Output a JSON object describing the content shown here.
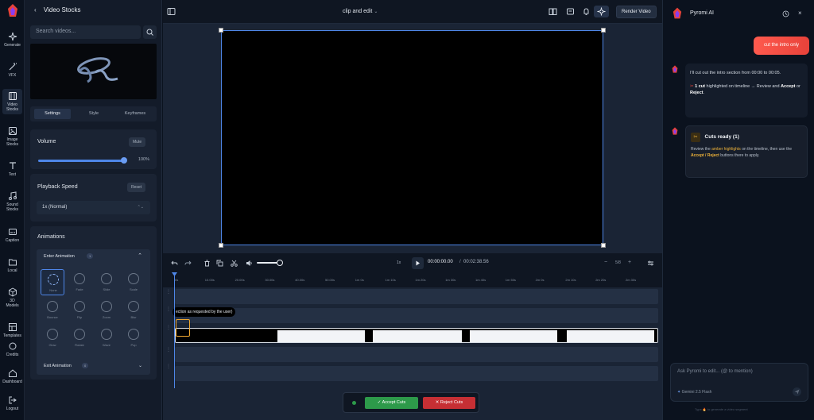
{
  "colors": {
    "accent": "#4e86e8",
    "accept": "#2d9a4a",
    "reject": "#c62f34",
    "amber": "#f0b43a",
    "user_bubble": "#ff5a4e"
  },
  "rail": {
    "items": [
      {
        "label": "Generate",
        "icon": "sparkles-icon"
      },
      {
        "label": "VFX",
        "icon": "magic-icon"
      },
      {
        "label": "Video Stocks",
        "icon": "film-icon"
      },
      {
        "label": "Image Stocks",
        "icon": "image-icon"
      },
      {
        "label": "Text",
        "icon": "text-icon"
      },
      {
        "label": "Sound Stocks",
        "icon": "music-icon"
      },
      {
        "label": "Caption",
        "icon": "caption-icon"
      },
      {
        "label": "Local",
        "icon": "folder-icon"
      },
      {
        "label": "3D Models",
        "icon": "cube-icon"
      },
      {
        "label": "Templates",
        "icon": "template-icon"
      },
      {
        "label": "Credits",
        "icon": "coins-icon"
      },
      {
        "label": "Dashboard",
        "icon": "home-icon"
      },
      {
        "label": "Logout",
        "icon": "logout-icon"
      }
    ]
  },
  "left_panel": {
    "title": "Video Stocks",
    "search_placeholder": "Search videos...",
    "tabs": [
      "Settings",
      "Style",
      "Keyframes"
    ],
    "volume": {
      "title": "Volume",
      "button": "Mute",
      "value": "100%",
      "level": 1.0
    },
    "playback": {
      "title": "Playback Speed",
      "button": "Reset",
      "selected": "1x (Normal)"
    },
    "animations": {
      "title": "Animations",
      "enter": {
        "label": "Enter Animation",
        "count": "1"
      },
      "effects": [
        "None",
        "Fade",
        "Slide",
        "Scale",
        "Bounce",
        "Flip",
        "Zoom",
        "Blur",
        "Glow",
        "Rotate",
        "Wave",
        "Pop"
      ],
      "exit": {
        "label": "Exit Animation",
        "count": "0"
      }
    }
  },
  "main": {
    "project_title": "clip and edit",
    "render_label": "Render Video",
    "speed": "1x",
    "time_current": "00:00:00.00",
    "time_separator": "/",
    "time_total": "00:02:38.56",
    "zoom": "5/8",
    "ruler": [
      "0s",
      "10.00s",
      "20.00s",
      "30.00s",
      "40.00s",
      "50.00s",
      "1m 0s",
      "1m 10s",
      "1m 20s",
      "1m 30s",
      "1m 40s",
      "1m 50s",
      "2m 0s",
      "2m 10s",
      "2m 20s",
      "2m 30s"
    ],
    "tooltip": "ection as requested by the user)",
    "accept_label": "Accept Cuts",
    "reject_label": "Reject Cuts"
  },
  "assistant": {
    "title": "Pyromi AI",
    "user_message": "cut the intro only",
    "reply_line1": "I'll cut out the intro section from 00:00 to 00:05.",
    "reply_line2_bold": "1 cut",
    "reply_line2": " highlighted on timeline → Review and ",
    "accept_word": "Accept",
    "or_word": " or ",
    "reject_word": "Reject",
    "cuts_title": "Cuts ready (1)",
    "cuts_text1": "Review the ",
    "cuts_amber": "amber highlights",
    "cuts_text2": " on the timeline, then use the ",
    "cuts_buttons": "Accept / Reject",
    "cuts_text3": " buttons there to apply.",
    "input_placeholder": "Ask Pyromi to edit... (@ to mention)",
    "model": "Gemini 2.5 Flash",
    "footer": "Type 🔥 to generate a video segment"
  }
}
